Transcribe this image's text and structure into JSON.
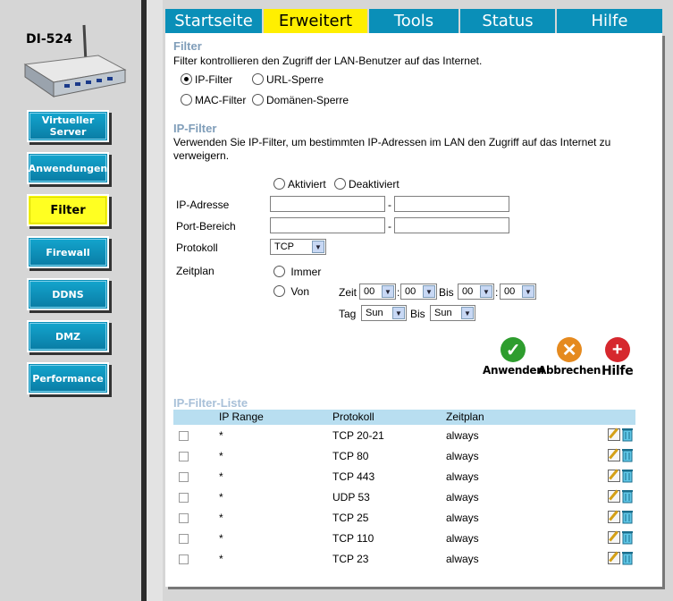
{
  "device": {
    "name": "DI-524"
  },
  "sidebar": {
    "items": [
      {
        "label": "Virtueller Server"
      },
      {
        "label": "Anwendungen"
      },
      {
        "label": "Filter"
      },
      {
        "label": "Firewall"
      },
      {
        "label": "DDNS"
      },
      {
        "label": "DMZ"
      },
      {
        "label": "Performance"
      }
    ],
    "active": "Filter"
  },
  "tabs": [
    {
      "label": "Startseite"
    },
    {
      "label": "Erweitert"
    },
    {
      "label": "Tools"
    },
    {
      "label": "Status"
    },
    {
      "label": "Hilfe"
    }
  ],
  "filter": {
    "title": "Filter",
    "desc": "Filter kontrollieren den Zugriff der LAN-Benutzer auf das Internet.",
    "options": [
      "IP-Filter",
      "URL-Sperre",
      "MAC-Filter",
      "Domänen-Sperre"
    ],
    "selected": "IP-Filter"
  },
  "ipfilter": {
    "title": "IP-Filter",
    "desc": "Verwenden Sie IP-Filter, um bestimmten IP-Adressen im LAN den Zugriff auf das Internet zu verweigern.",
    "enable_label": "Aktiviert",
    "disable_label": "Deaktiviert",
    "ip_label": "IP-Adresse",
    "port_label": "Port-Bereich",
    "proto_label": "Protokoll",
    "proto_value": "TCP",
    "schedule_label": "Zeitplan",
    "always_label": "Immer",
    "from_label": "Von",
    "time_label": "Zeit",
    "to_label": "Bis",
    "day_label": "Tag",
    "dash": "-",
    "colon": ":",
    "time_values": [
      "00",
      "00",
      "00",
      "00"
    ],
    "day_from": "Sun",
    "day_to": "Sun"
  },
  "actions": {
    "apply": "Anwenden",
    "cancel": "Abbrechen",
    "help": "Hilfe"
  },
  "list": {
    "title": "IP-Filter-Liste",
    "headers": [
      "IP Range",
      "Protokoll",
      "Zeitplan"
    ],
    "rows": [
      {
        "ip": "*",
        "proto": "TCP 20-21",
        "sched": "always"
      },
      {
        "ip": "*",
        "proto": "TCP 80",
        "sched": "always"
      },
      {
        "ip": "*",
        "proto": "TCP 443",
        "sched": "always"
      },
      {
        "ip": "*",
        "proto": "UDP 53",
        "sched": "always"
      },
      {
        "ip": "*",
        "proto": "TCP 25",
        "sched": "always"
      },
      {
        "ip": "*",
        "proto": "TCP 110",
        "sched": "always"
      },
      {
        "ip": "*",
        "proto": "TCP 23",
        "sched": "always"
      }
    ]
  },
  "colors": {
    "tab_blue": "#0a8fb8",
    "active_yellow": "#ffef00",
    "section_title": "#7f9db9",
    "list_header": "#b8def0"
  }
}
